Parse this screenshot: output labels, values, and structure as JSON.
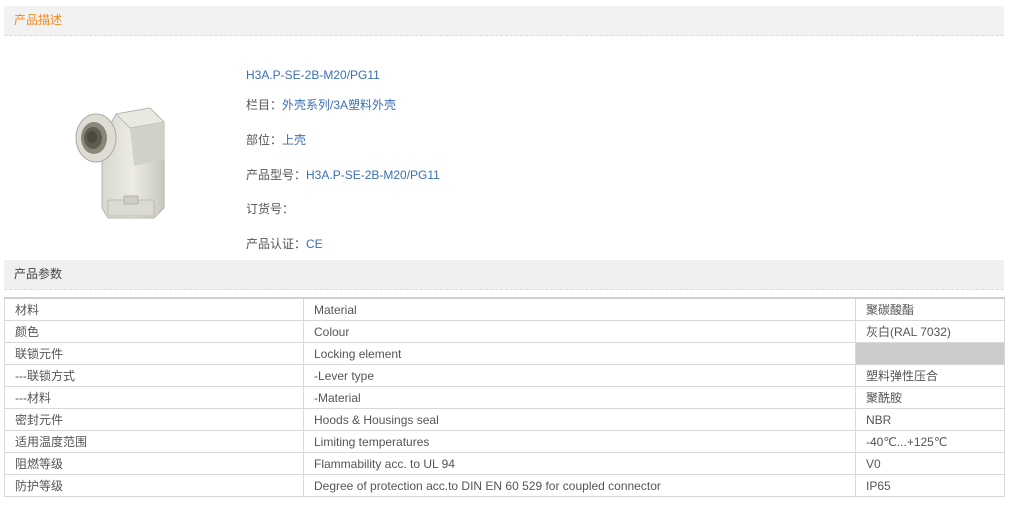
{
  "sections": {
    "description_title": "产品描述",
    "params_title": "产品参数"
  },
  "product": {
    "name": "H3A.P-SE-2B-M20/PG11",
    "category_label": "栏目：",
    "category_value": "外壳系列/3A塑料外壳",
    "part_label": "部位：",
    "part_value": "上壳",
    "model_label": "产品型号：",
    "model_value": "H3A.P-SE-2B-M20/PG11",
    "order_label": "订货号：",
    "order_value": "",
    "cert_label": "产品认证：",
    "cert_value": "CE"
  },
  "params": [
    {
      "cn": "材料",
      "en": "Material",
      "value": "聚碳酸酯"
    },
    {
      "cn": "颜色",
      "en": "Colour",
      "value": "灰白(RAL 7032)"
    },
    {
      "cn": "联锁元件",
      "en": "Locking element",
      "value": ""
    },
    {
      "cn": "---联锁方式",
      "en": "-Lever type",
      "value": "塑料弹性压合"
    },
    {
      "cn": "---材料",
      "en": "-Material",
      "value": "聚酰胺"
    },
    {
      "cn": "密封元件",
      "en": "Hoods & Housings seal",
      "value": "NBR"
    },
    {
      "cn": "适用温度范围",
      "en": "Limiting temperatures",
      "value": "-40℃...+125℃"
    },
    {
      "cn": "阻燃等级",
      "en": "Flammability acc. to UL 94",
      "value": "V0"
    },
    {
      "cn": "防护等级",
      "en": "Degree of protection acc.to DIN EN 60 529 for coupled connector",
      "value": "IP65"
    }
  ]
}
